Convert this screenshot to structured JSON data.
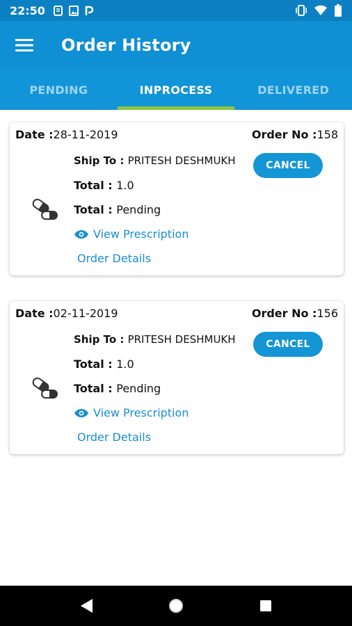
{
  "status_bar": {
    "time": "22:50",
    "left_icons": [
      "notification-icon",
      "image-icon",
      "p-icon"
    ],
    "right_icons": [
      "vibrate-icon",
      "wifi-icon",
      "battery-icon"
    ]
  },
  "app_bar": {
    "menu_icon": "hamburger-menu-icon",
    "title": "Order History"
  },
  "tabs": [
    {
      "label": "PENDING",
      "active": false
    },
    {
      "label": "INPROCESS",
      "active": true
    },
    {
      "label": "DELIVERED",
      "active": false
    }
  ],
  "orders": [
    {
      "date_label": "Date :",
      "date": "28-11-2019",
      "order_label": "Order No :",
      "order_no": "158",
      "ship_label": "Ship To : ",
      "ship_to": "PRITESH DESHMUKH",
      "total1_label": "Total : ",
      "total1": "1.0",
      "total2_label": "Total : ",
      "total2": "Pending",
      "view_rx": "View Prescription",
      "order_details": "Order Details",
      "cancel": "CANCEL"
    },
    {
      "date_label": "Date :",
      "date": "02-11-2019",
      "order_label": "Order No :",
      "order_no": "156",
      "ship_label": "Ship To : ",
      "ship_to": "PRITESH DESHMUKH",
      "total1_label": "Total : ",
      "total1": "1.0",
      "total2_label": "Total : ",
      "total2": "Pending",
      "view_rx": "View Prescription",
      "order_details": "Order Details",
      "cancel": "CANCEL"
    }
  ],
  "colors": {
    "primary": "#0f8fd4",
    "tab_indicator": "#8dc63f",
    "link": "#1a8ed0"
  }
}
